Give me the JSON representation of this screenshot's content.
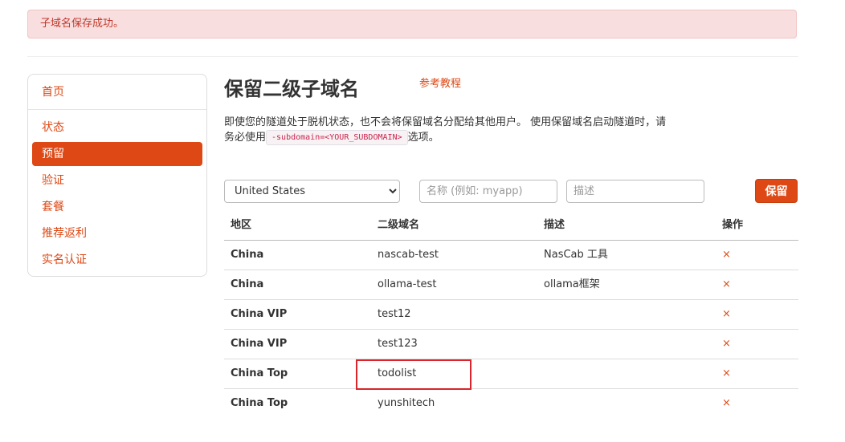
{
  "alert": {
    "message": "子域名保存成功。"
  },
  "sidebar": {
    "items": [
      {
        "label": "首页",
        "active": false
      },
      {
        "label": "状态",
        "active": false
      },
      {
        "label": "预留",
        "active": true
      },
      {
        "label": "验证",
        "active": false
      },
      {
        "label": "套餐",
        "active": false
      },
      {
        "label": "推荐返利",
        "active": false
      },
      {
        "label": "实名认证",
        "active": false
      }
    ]
  },
  "page": {
    "title": "保留二级子域名",
    "ref_link": "参考教程",
    "desc_before": "即使您的隧道处于脱机状态，也不会将保留域名分配给其他用户。 使用保留域名启动隧道时，请务必使用",
    "desc_code": "-subdomain=<YOUR_SUBDOMAIN>",
    "desc_after": "选项。"
  },
  "form": {
    "region_selected": "United States",
    "name_placeholder": "名称 (例如: myapp)",
    "desc_placeholder": "描述",
    "save_label": "保留"
  },
  "table": {
    "headers": {
      "region": "地区",
      "subdomain": "二级域名",
      "description": "描述",
      "action": "操作"
    },
    "rows": [
      {
        "region": "China",
        "subdomain": "nascab-test",
        "description": "NasCab 工具",
        "action": "×"
      },
      {
        "region": "China",
        "subdomain": "ollama-test",
        "description": "ollama框架",
        "action": "×"
      },
      {
        "region": "China VIP",
        "subdomain": "test12",
        "description": "",
        "action": "×"
      },
      {
        "region": "China VIP",
        "subdomain": "test123",
        "description": "",
        "action": "×"
      },
      {
        "region": "China Top",
        "subdomain": "todolist",
        "description": "",
        "action": "×"
      },
      {
        "region": "China Top",
        "subdomain": "yunshitech",
        "description": "",
        "action": "×"
      }
    ]
  },
  "colors": {
    "accent": "#dd4814",
    "alert_bg": "#f8dede",
    "highlight": "#d9252b"
  }
}
